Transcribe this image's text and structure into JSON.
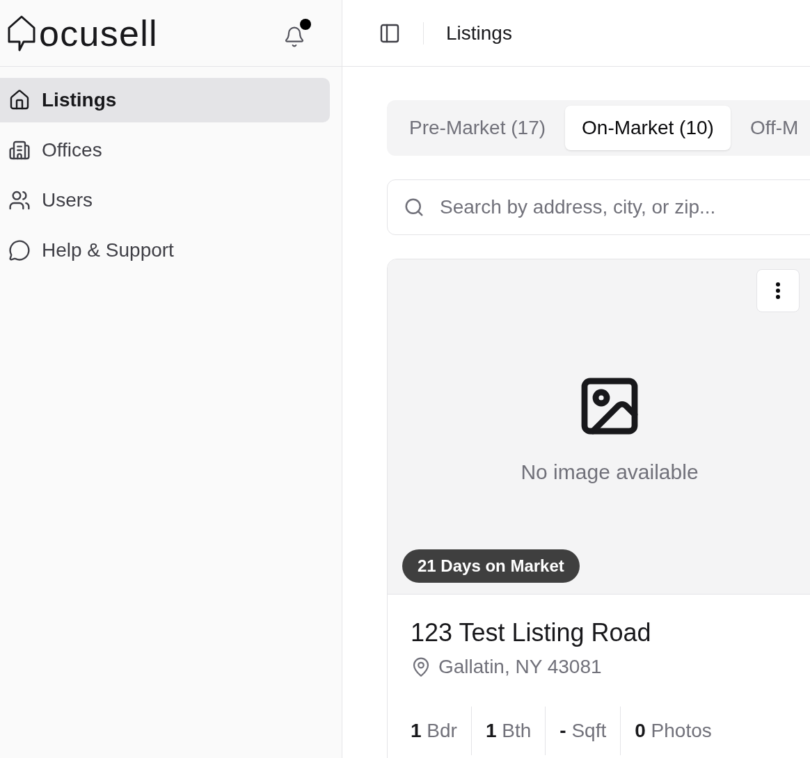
{
  "sidebar": {
    "logo": "ocusell",
    "notification": {
      "unread": true
    },
    "items": [
      {
        "label": "Listings",
        "selected": true
      },
      {
        "label": "Offices",
        "selected": false
      },
      {
        "label": "Users",
        "selected": false
      },
      {
        "label": "Help & Support",
        "selected": false
      }
    ]
  },
  "header": {
    "title": "Listings"
  },
  "tabs": [
    {
      "label": "Pre-Market (17)",
      "selected": false
    },
    {
      "label": "On-Market (10)",
      "selected": true
    },
    {
      "label": "Off-M",
      "selected": false
    }
  ],
  "search": {
    "placeholder": "Search by address, city, or zip..."
  },
  "listing": {
    "image_text": "No image available",
    "badge": "21 Days on Market",
    "title": "123 Test Listing Road",
    "location": "Gallatin, NY 43081",
    "stats": [
      {
        "value": "1",
        "unit": "Bdr"
      },
      {
        "value": "1",
        "unit": "Bth"
      },
      {
        "value": "-",
        "unit": "Sqft"
      },
      {
        "value": "0",
        "unit": "Photos"
      }
    ]
  }
}
